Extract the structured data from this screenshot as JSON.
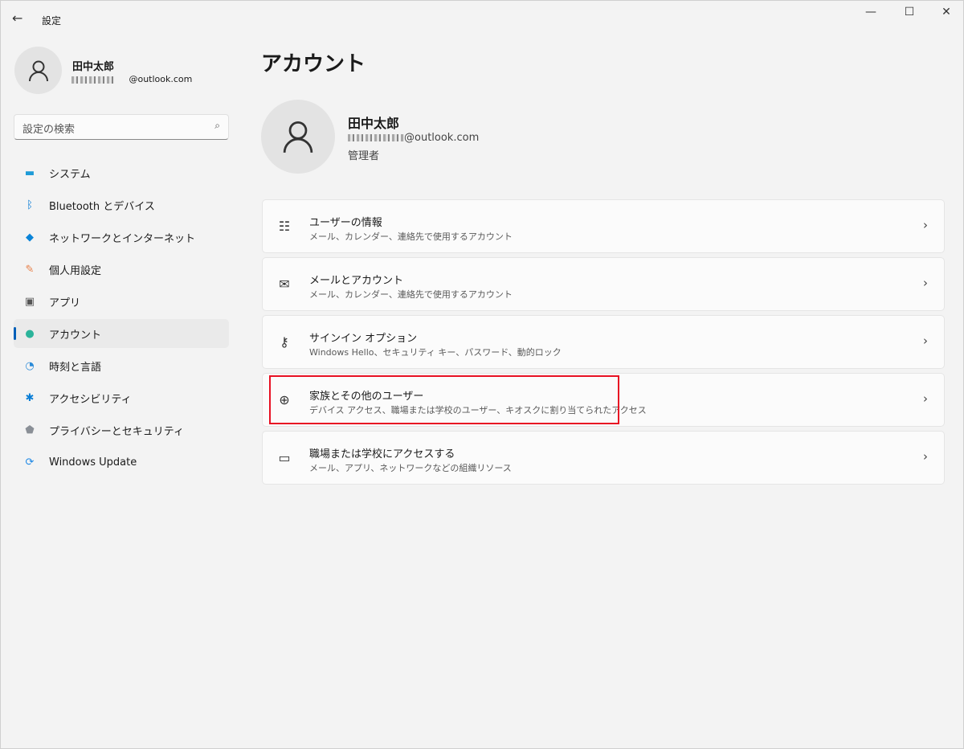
{
  "window": {
    "title": "設定",
    "back_icon": "arrow-left-icon",
    "minimize": "—",
    "maximize": "☐",
    "close": "✕"
  },
  "profile": {
    "name": "田中太郎",
    "email_suffix": "@outlook.com",
    "role": "管理者"
  },
  "search": {
    "placeholder": "設定の検索"
  },
  "sidebar": {
    "items": [
      {
        "label": "システム",
        "icon": "system-icon",
        "color": "#1e9bd7"
      },
      {
        "label": "Bluetooth とデバイス",
        "icon": "bluetooth-icon",
        "color": "#0078d4"
      },
      {
        "label": "ネットワークとインターネット",
        "icon": "wifi-icon",
        "color": "#0a84d8"
      },
      {
        "label": "個人用設定",
        "icon": "brush-icon",
        "color": "#e8804a"
      },
      {
        "label": "アプリ",
        "icon": "apps-icon",
        "color": "#555555"
      },
      {
        "label": "アカウント",
        "icon": "account-icon",
        "color": "#2bb39a",
        "selected": true
      },
      {
        "label": "時刻と言語",
        "icon": "clock-globe-icon",
        "color": "#2a8ad8"
      },
      {
        "label": "アクセシビリティ",
        "icon": "accessibility-icon",
        "color": "#0a7ed6"
      },
      {
        "label": "プライバシーとセキュリティ",
        "icon": "shield-icon",
        "color": "#8a8f96"
      },
      {
        "label": "Windows Update",
        "icon": "update-icon",
        "color": "#1e88e5"
      }
    ]
  },
  "main": {
    "title": "アカウント",
    "cards": [
      {
        "title": "ユーザーの情報",
        "subtitle": "メール、カレンダー、連絡先で使用するアカウント",
        "icon": "user-info-icon"
      },
      {
        "title": "メールとアカウント",
        "subtitle": "メール、カレンダー、連絡先で使用するアカウント",
        "icon": "mail-icon"
      },
      {
        "title": "サインイン オプション",
        "subtitle": "Windows Hello、セキュリティ キー、パスワード、動的ロック",
        "icon": "key-icon"
      },
      {
        "title": "家族とその他のユーザー",
        "subtitle": "デバイス アクセス、職場または学校のユーザー、キオスクに割り当てられたアクセス",
        "icon": "add-user-icon",
        "highlighted": true
      },
      {
        "title": "職場または学校にアクセスする",
        "subtitle": "メール、アプリ、ネットワークなどの組織リソース",
        "icon": "briefcase-icon"
      }
    ]
  },
  "highlight_color": "#e81123"
}
